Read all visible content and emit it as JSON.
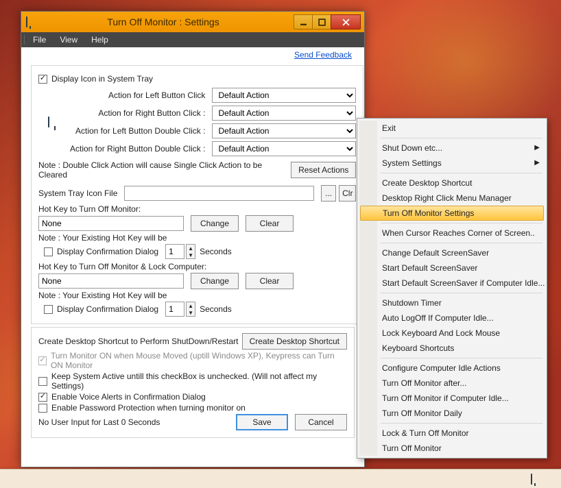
{
  "window": {
    "title": "Turn Off Monitor : Settings",
    "menubar": [
      "File",
      "View",
      "Help"
    ]
  },
  "feedback_link": "Send Feedback",
  "display_icon_label": "Display Icon in System Tray",
  "actions": {
    "left_click": {
      "label": "Action for Left Button Click",
      "value": "Default Action"
    },
    "right_click": {
      "label": "Action for Right Button Click :",
      "value": "Default Action"
    },
    "left_dbl": {
      "label": "Action for Left Button Double Click :",
      "value": "Default Action"
    },
    "right_dbl": {
      "label": "Action for Right Button Double Click :",
      "value": "Default Action"
    }
  },
  "note_dbl": "Note : Double Click Action will cause Single Click Action to be Cleared",
  "reset_actions": "Reset Actions",
  "tray_icon_file_label": "System Tray Icon File",
  "browse_btn": "...",
  "clr_btn": "Clr",
  "hotkey1": {
    "label": "Hot Key to Turn Off Monitor:",
    "value": "None",
    "change": "Change",
    "clear": "Clear",
    "note": "Note : Your Existing Hot Key will be",
    "confirm_label": "Display Confirmation Dialog",
    "seconds": "1",
    "seconds_label": "Seconds"
  },
  "hotkey2": {
    "label": "Hot Key to Turn Off Monitor & Lock Computer:",
    "value": "None",
    "change": "Change",
    "clear": "Clear",
    "note": "Note : Your Existing Hot Key will be",
    "confirm_label": "Display Confirmation Dialog",
    "seconds": "1",
    "seconds_label": "Seconds"
  },
  "shortcut_section": {
    "label": "Create Desktop Shortcut to Perform ShutDown/Restart",
    "button": "Create Desktop Shortcut"
  },
  "options": {
    "turn_on_mouse": "Turn Monitor ON when Mouse Moved (uptill Windows XP), Keypress can Turn ON Monitor",
    "keep_active": "Keep System Active untill this checkBox is unchecked.  (Will not affect my Settings)",
    "voice_alerts": "Enable Voice Alerts in Confirmation Dialog",
    "password": "Enable Password Protection when turning monitor on",
    "no_input": "No User Input for Last 0 Seconds"
  },
  "save": "Save",
  "cancel": "Cancel",
  "context_menu": {
    "items": [
      {
        "label": "Exit"
      },
      {
        "sep": true
      },
      {
        "label": "Shut Down etc...",
        "submenu": true
      },
      {
        "label": "System Settings",
        "submenu": true
      },
      {
        "sep": true
      },
      {
        "label": "Create Desktop Shortcut"
      },
      {
        "label": "Desktop Right Click Menu Manager"
      },
      {
        "label": "Turn Off Monitor Settings",
        "selected": true
      },
      {
        "sep": true
      },
      {
        "label": "When Cursor Reaches Corner of Screen.."
      },
      {
        "sep": true
      },
      {
        "label": "Change Default ScreenSaver"
      },
      {
        "label": "Start Default ScreenSaver"
      },
      {
        "label": "Start Default ScreenSaver if Computer Idle..."
      },
      {
        "sep": true
      },
      {
        "label": "Shutdown Timer"
      },
      {
        "label": "Auto LogOff If Computer Idle..."
      },
      {
        "label": "Lock Keyboard And Lock Mouse"
      },
      {
        "label": "Keyboard Shortcuts"
      },
      {
        "sep": true
      },
      {
        "label": "Configure Computer Idle Actions"
      },
      {
        "label": "Turn Off Monitor after..."
      },
      {
        "label": "Turn Off Monitor if Computer Idle..."
      },
      {
        "label": "Turn Off Monitor Daily"
      },
      {
        "sep": true
      },
      {
        "label": "Lock & Turn Off Monitor"
      },
      {
        "label": "Turn Off Monitor"
      }
    ]
  }
}
